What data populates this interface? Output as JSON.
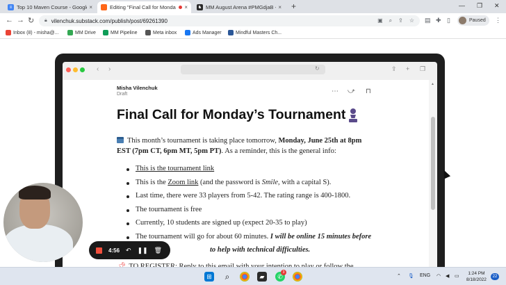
{
  "browser": {
    "tabs": [
      {
        "title": "Top 10 Maven Course - Google D",
        "color": "#4285f4"
      },
      {
        "title": "Editing \"Final Call for Monda",
        "color": "#ff6719"
      },
      {
        "title": "MM August Arena #PMGdjaB - l",
        "color": "#2b2b2b"
      }
    ],
    "url": "vilenchuk.substack.com/publish/post/69261390",
    "profile_label": "Paused",
    "bookmarks": [
      {
        "label": "Inbox (8) - misha@...",
        "color": "#ea4335"
      },
      {
        "label": "MM Drive",
        "color": "#34a853"
      },
      {
        "label": "MM Pipeline",
        "color": "#0f9d58"
      },
      {
        "label": "Meta inbox",
        "color": "#555555"
      },
      {
        "label": "Ads Manager",
        "color": "#1877f2"
      },
      {
        "label": "Mindful Masters Ch...",
        "color": "#2b5797"
      }
    ]
  },
  "post": {
    "author": "Misha Vilenchuk",
    "status": "Draft",
    "title": "Final Call for Monday’s Tournament",
    "intro_line1_plain": "This month’s tournament is taking place tomorrow, ",
    "intro_line1_bold": "Monday, June 25th at 8pm",
    "intro_line2_bold": "EST (7pm CT, 6pm MT, 5pm PT)",
    "intro_line2_plain": ".  As a reminder, this is the general info:",
    "bullets": {
      "b1_link": "This is the tournament link",
      "b2_pre": "This is the ",
      "b2_link": "Zoom link",
      "b2_mid": " (and the password is ",
      "b2_em": "Smile",
      "b2_post": ", with a capital S).",
      "b3": "Last time, there were 33 players from 5-42. The rating range is 400-1800.",
      "b4": "The tournament is free",
      "b5": "Currently, 10 students are signed up (expect 20-35 to play)",
      "b6_pre": "The tournament will go for about 60 minutes. ",
      "b6_em": "I will be online 15 minutes before",
      "b7_em": "to help with technical difficulties."
    },
    "register_line": "TO REGISTER: Reply to this email with your intention to play or follow the"
  },
  "recording": {
    "time": "4:56"
  },
  "taskbar": {
    "language": "ENG",
    "time": "1:24 PM",
    "date": "8/18/2022",
    "notifications": "22",
    "whatsapp_badge": "3"
  },
  "colors": {
    "accent_substack": "#ff6719",
    "record_stop": "#f24f3d"
  }
}
